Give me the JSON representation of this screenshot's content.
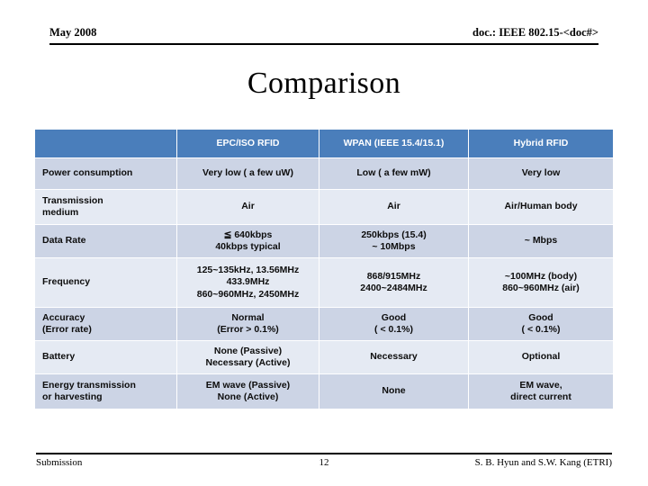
{
  "header": {
    "left": "May 2008",
    "right": "doc.: IEEE 802.15-<doc#>"
  },
  "title": "Comparison",
  "footer": {
    "left": "Submission",
    "page": "12",
    "right": "S. B. Hyun and S.W. Kang (ETRI)"
  },
  "colors": {
    "header_blue": "#4a7ebb",
    "row_band_dark": "#ccd4e5",
    "row_band_light": "#e5eaf3",
    "text": "#0d0d0d",
    "header_text": "#ffffff"
  },
  "table": {
    "columns": [
      "",
      "EPC/ISO RFID",
      "WPAN (IEEE 15.4/15.1)",
      "Hybrid RFID"
    ],
    "rows": [
      {
        "label": "Power consumption",
        "cells": [
          [
            "Very low ( a few uW)"
          ],
          [
            "Low ( a few mW)"
          ],
          [
            "Very low"
          ]
        ]
      },
      {
        "label": "Transmission medium",
        "label_lines": [
          "Transmission",
          "medium"
        ],
        "cells": [
          [
            "Air"
          ],
          [
            "Air"
          ],
          [
            "Air/Human body"
          ]
        ]
      },
      {
        "label": "Data Rate",
        "cells": [
          [
            "≦ 640kbps",
            "40kbps typical"
          ],
          [
            "250kbps (15.4)",
            "~ 10Mbps"
          ],
          [
            "~ Mbps"
          ]
        ]
      },
      {
        "label": "Frequency",
        "cells": [
          [
            "125~135kHz, 13.56MHz",
            "433.9MHz",
            "860~960MHz, 2450MHz"
          ],
          [
            "868/915MHz",
            "2400~2484MHz"
          ],
          [
            "~100MHz (body)",
            "860~960MHz (air)"
          ]
        ]
      },
      {
        "label": "Accuracy (Error rate)",
        "label_lines": [
          "Accuracy",
          " (Error rate)"
        ],
        "cells": [
          [
            "Normal",
            "(Error > 0.1%)"
          ],
          [
            "Good",
            "( < 0.1%)"
          ],
          [
            "Good",
            "( < 0.1%)"
          ]
        ]
      },
      {
        "label": "Battery",
        "cells": [
          [
            "None (Passive)",
            "Necessary (Active)"
          ],
          [
            "Necessary"
          ],
          [
            "Optional"
          ]
        ]
      },
      {
        "label": "Energy transmission or harvesting",
        "label_lines": [
          "Energy transmission",
          "or harvesting"
        ],
        "cells": [
          [
            "EM wave (Passive)",
            "None (Active)"
          ],
          [
            "None"
          ],
          [
            "EM wave,",
            "direct current"
          ]
        ]
      }
    ]
  }
}
